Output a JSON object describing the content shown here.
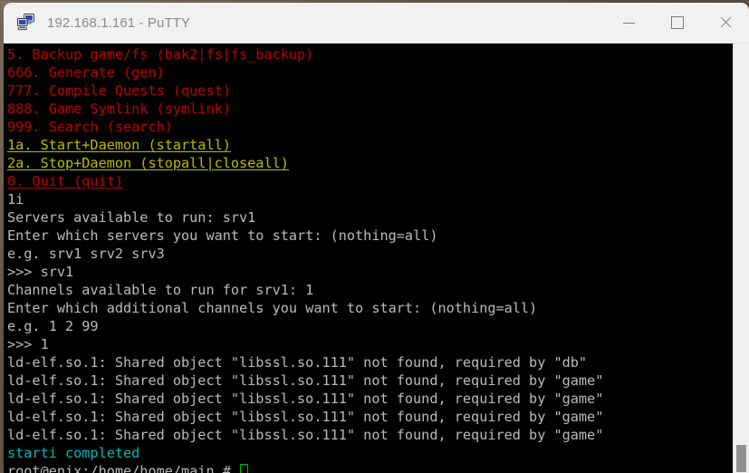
{
  "window": {
    "title": "192.168.1.161 - PuTTY",
    "icon": "putty-computer-icon",
    "controls": {
      "minimize_label": "—",
      "maximize_label": "□",
      "close_label": "✕"
    }
  },
  "colors": {
    "red": "#bb0000",
    "yellow": "#bbbb00",
    "cyan": "#00bbbb",
    "white": "#bbbbbb",
    "cursor_green": "#00bb00",
    "terminal_bg": "#000000",
    "titlebar_bg": "#f1f1f1",
    "title_text": "#8a8a8a"
  },
  "terminal": {
    "menu": [
      {
        "text": "5. Backup game/fs (bak2|fs|fs_backup)",
        "color": "red",
        "underline": false
      },
      {
        "text": "666. Generate (gen)",
        "color": "red",
        "underline": false
      },
      {
        "text": "777. Compile Quests (quest)",
        "color": "red",
        "underline": false
      },
      {
        "text": "888. Game Symlink (symlink)",
        "color": "red",
        "underline": false
      },
      {
        "text": "999. Search (search)",
        "color": "red",
        "underline": false
      },
      {
        "text": "1a. Start+Daemon (startall)",
        "color": "yellow",
        "underline": true
      },
      {
        "text": "2a. Stop+Daemon (stopall|closeall)",
        "color": "yellow",
        "underline": true
      },
      {
        "text": "0. Quit (quit)",
        "color": "red",
        "underline": true
      }
    ],
    "session": [
      {
        "text": "1i",
        "color": "white"
      },
      {
        "text": "Servers available to run: srv1",
        "color": "white"
      },
      {
        "text": "Enter which servers you want to start: (nothing=all)",
        "color": "white"
      },
      {
        "text": "e.g. srv1 srv2 srv3",
        "color": "white"
      },
      {
        "text": ">>> srv1",
        "color": "white"
      },
      {
        "text": "Channels available to run for srv1: 1",
        "color": "white"
      },
      {
        "text": "Enter which additional channels you want to start: (nothing=all)",
        "color": "white"
      },
      {
        "text": "e.g. 1 2 99",
        "color": "white"
      },
      {
        "text": ">>> 1",
        "color": "white"
      },
      {
        "text": "ld-elf.so.1: Shared object \"libssl.so.111\" not found, required by \"db\"",
        "color": "white"
      },
      {
        "text": "ld-elf.so.1: Shared object \"libssl.so.111\" not found, required by \"game\"",
        "color": "white"
      },
      {
        "text": "ld-elf.so.1: Shared object \"libssl.so.111\" not found, required by \"game\"",
        "color": "white"
      },
      {
        "text": "ld-elf.so.1: Shared object \"libssl.so.111\" not found, required by \"game\"",
        "color": "white"
      },
      {
        "text": "ld-elf.so.1: Shared object \"libssl.so.111\" not found, required by \"game\"",
        "color": "white"
      },
      {
        "text": "starti completed",
        "color": "cyan"
      }
    ],
    "prompt": {
      "text": "root@enix:/home/home/main # ",
      "color": "white"
    }
  },
  "scrollbar": {
    "name": "vertical-scrollbar",
    "thumb_position": "bottom"
  }
}
